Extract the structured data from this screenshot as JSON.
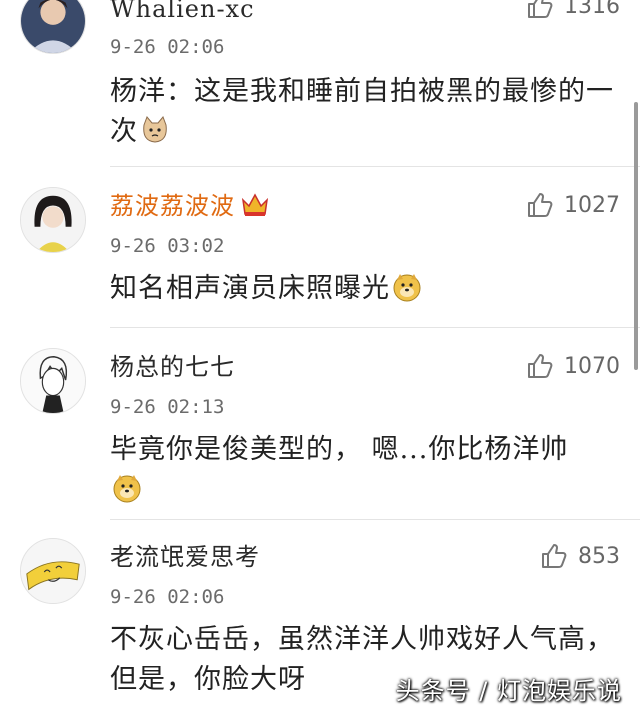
{
  "comments": [
    {
      "username": "Whalien-xc",
      "likes": "1316",
      "time": "9-26 02:06",
      "text": "杨洋：这是我和睡前自拍被黑的最惨的一次",
      "emoji": "cat-emoji"
    },
    {
      "username": "荔波荔波波",
      "likes": "1027",
      "time": "9-26 03:02",
      "text": "知名相声演员床照曝光",
      "emoji": "doge-emoji",
      "badge": "crown-icon"
    },
    {
      "username": "杨总的七七",
      "likes": "1070",
      "time": "9-26 02:13",
      "text": "毕竟你是俊美型的， 嗯...你比杨洋帅",
      "emoji": "doge-emoji"
    },
    {
      "username": "老流氓爱思考",
      "likes": "853",
      "time": "9-26 02:06",
      "text": "不灰心岳岳，虽然洋洋人帅戏好人气高，但是，你脸大呀"
    }
  ],
  "watermark": "头条号 / 灯泡娱乐说",
  "colors": {
    "vip_name": "#e06a12",
    "divider": "#e4e4e4",
    "time": "#6b6b6b"
  }
}
